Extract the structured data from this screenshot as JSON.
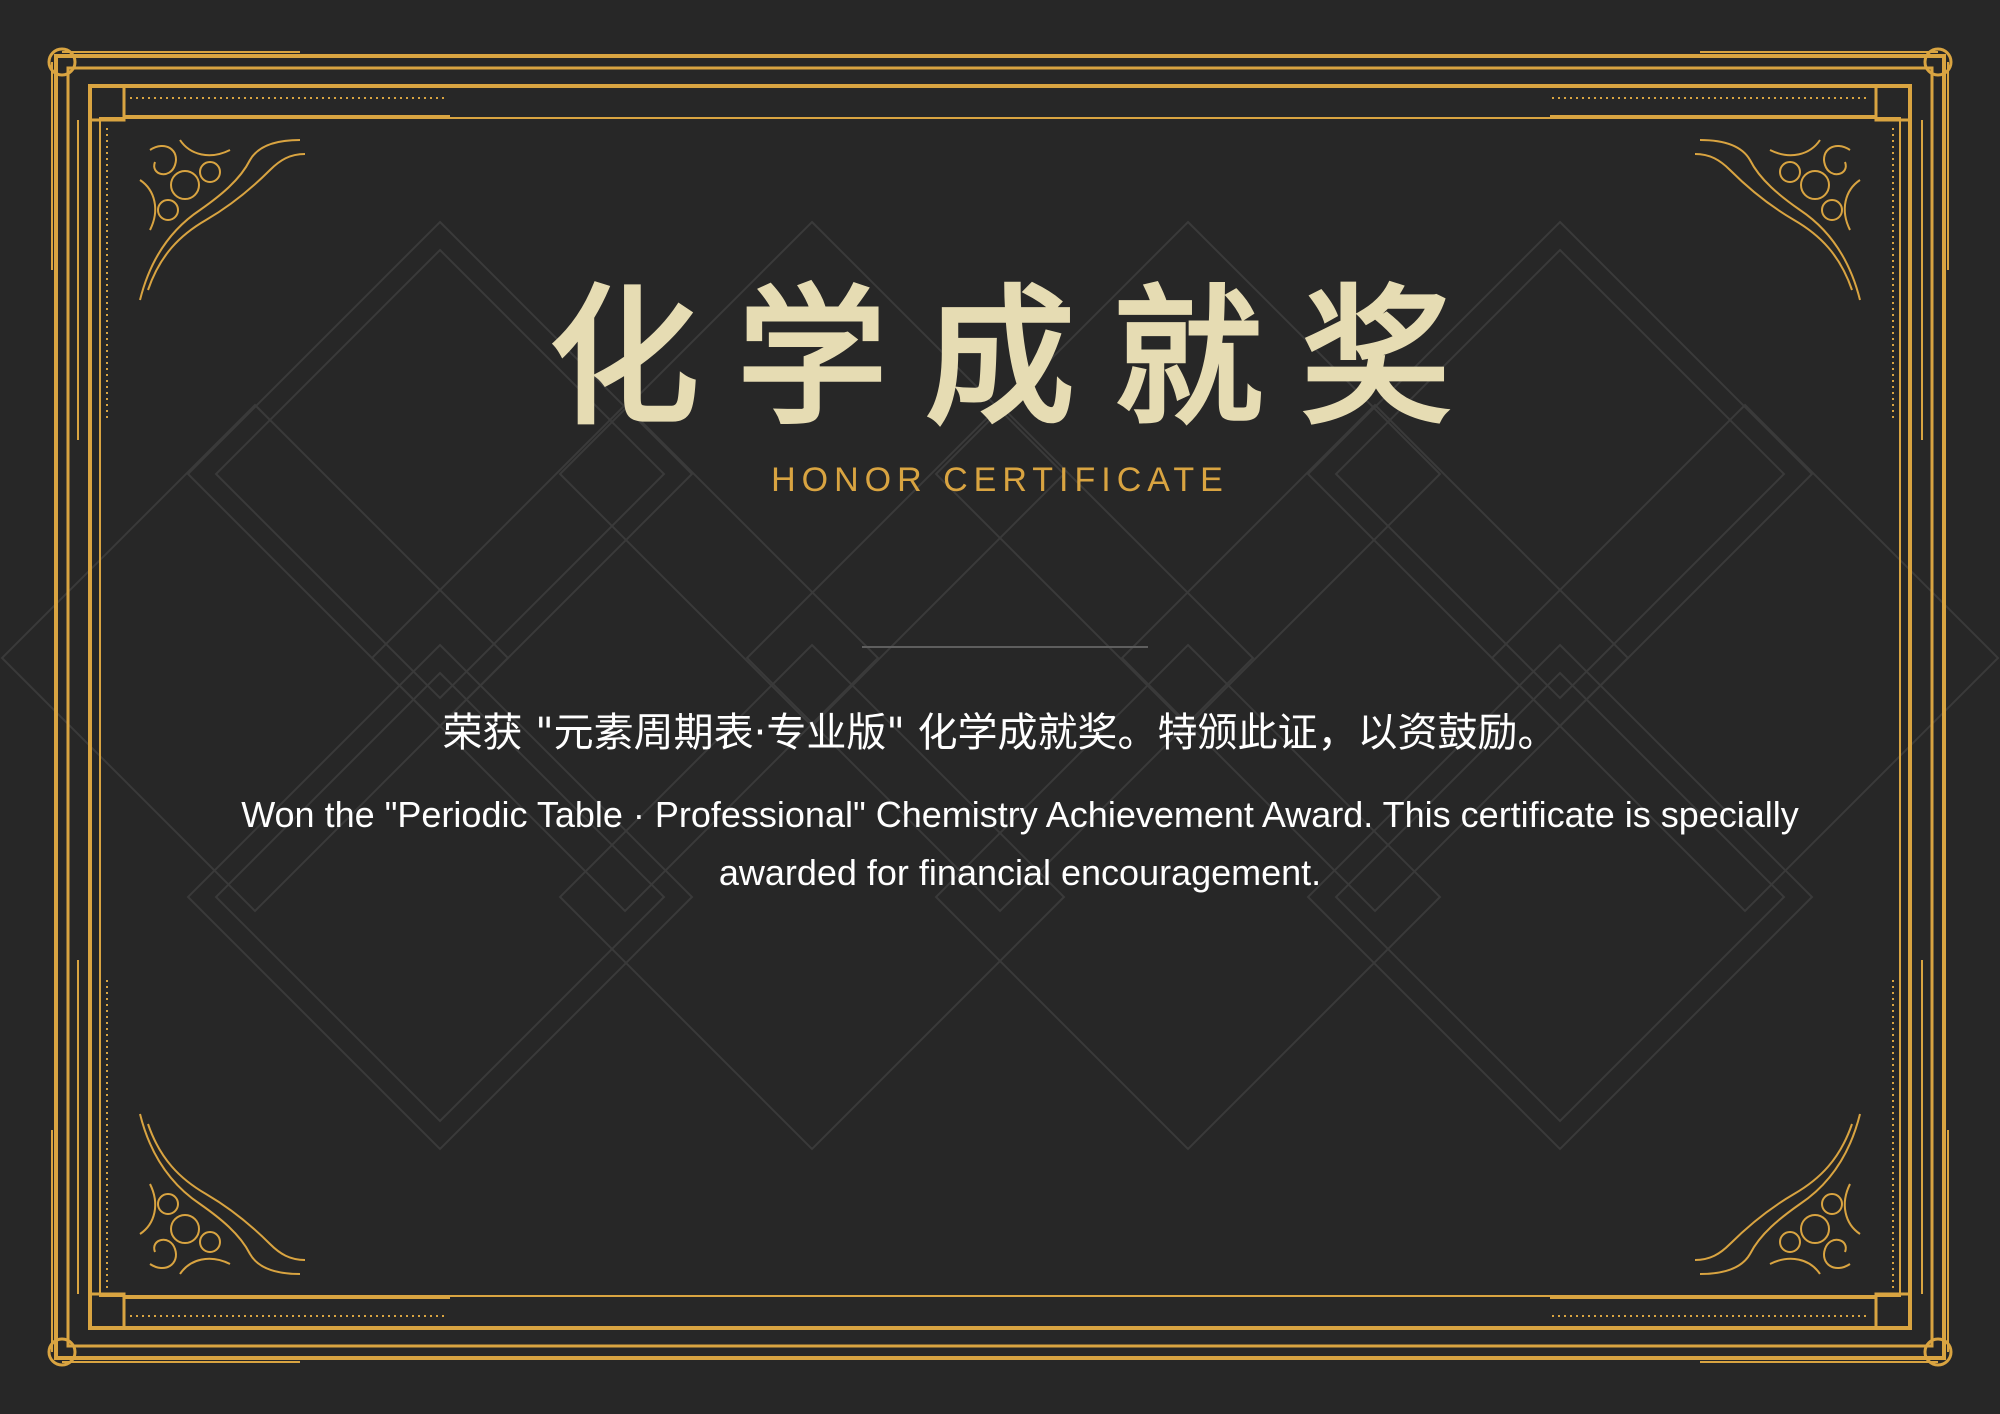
{
  "certificate": {
    "title": "化学成就奖",
    "subtitle": "HONOR CERTIFICATE",
    "text_cn": "荣获 \"元素周期表·专业版\" 化学成就奖。特颁此证，以资鼓励。",
    "text_en": "Won the \"Periodic Table · Professional\" Chemistry Achievement Award. This certificate is specially awarded for financial encouragement."
  },
  "colors": {
    "background": "#272727",
    "gold": "#d9a441",
    "title": "#e6dcb3",
    "text": "#ffffff"
  }
}
